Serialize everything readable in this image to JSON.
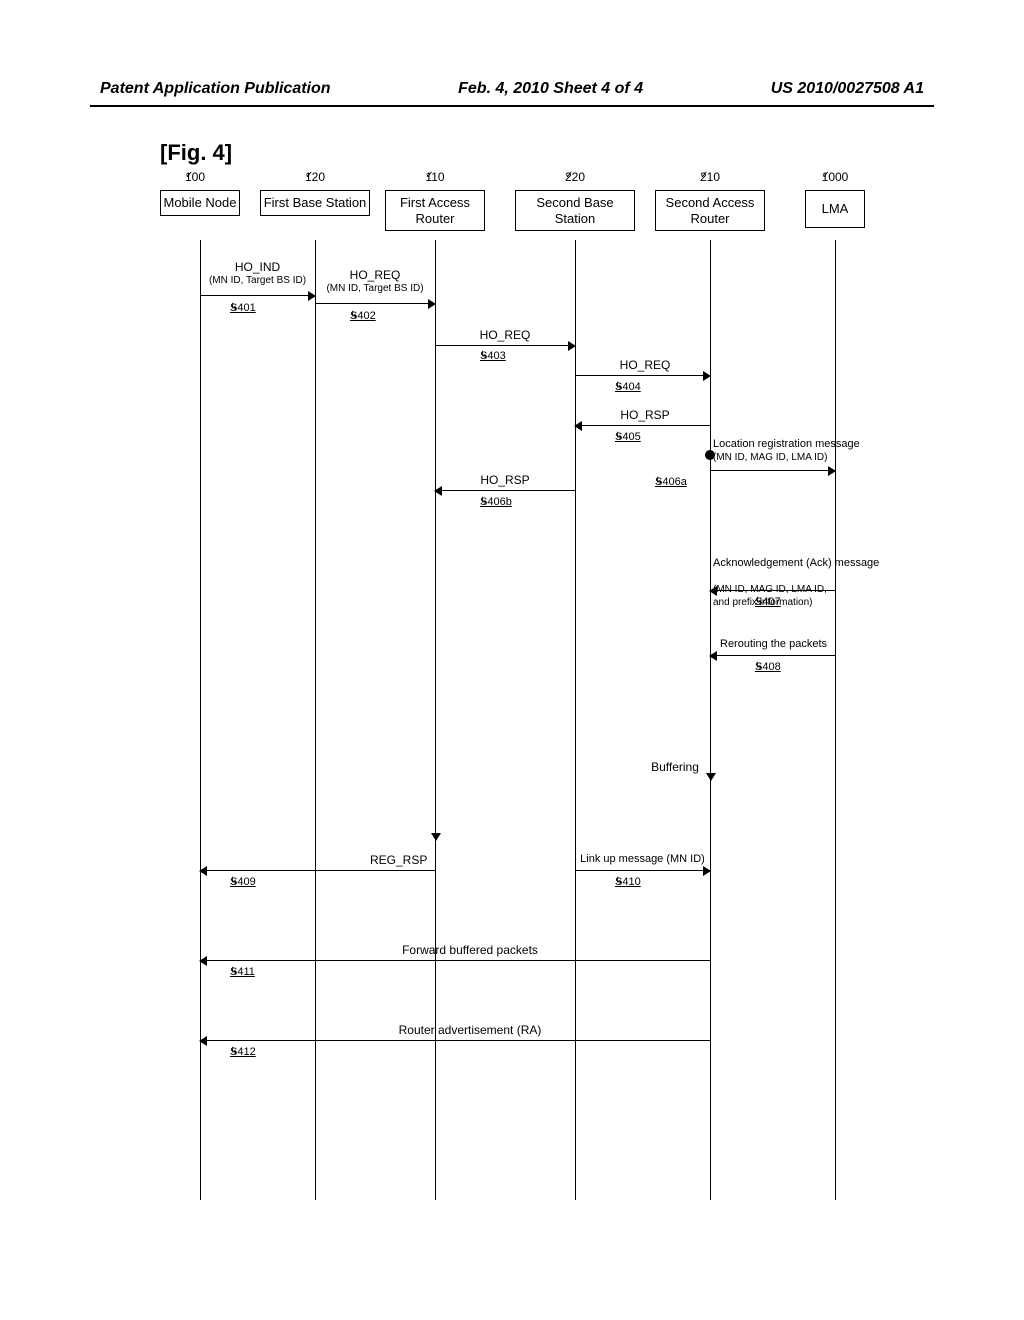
{
  "header": {
    "left": "Patent Application Publication",
    "center": "Feb. 4, 2010  Sheet 4 of 4",
    "right": "US 2010/0027508 A1"
  },
  "figure_label": "[Fig. 4]",
  "actors": {
    "mobile_node": {
      "name": "Mobile Node",
      "id": "100"
    },
    "first_bs": {
      "name": "First Base Station",
      "id": "120"
    },
    "first_ar": {
      "name": "First Access\nRouter",
      "id": "110"
    },
    "second_bs": {
      "name": "Second Base Station",
      "id": "220"
    },
    "second_ar": {
      "name": "Second Access\nRouter",
      "id": "210"
    },
    "lma": {
      "name": "LMA",
      "id": "1000"
    }
  },
  "messages": {
    "ho_ind": {
      "text": "HO_IND",
      "sub": "(MN ID, Target BS ID)",
      "step": "S401"
    },
    "ho_req1": {
      "text": "HO_REQ",
      "sub": "(MN ID, Target BS ID)",
      "step": "S402"
    },
    "ho_req2": {
      "text": "HO_REQ",
      "step": "S403"
    },
    "ho_req3": {
      "text": "HO_REQ",
      "step": "S404"
    },
    "ho_rsp1": {
      "text": "HO_RSP",
      "step": "S405"
    },
    "locreg": {
      "text": "Location registration message",
      "sub": "(MN ID, MAG ID, LMA ID)",
      "step": "S406a"
    },
    "ho_rsp2": {
      "text": "HO_RSP",
      "step": "S406b"
    },
    "ack": {
      "text": "Acknowledgement (Ack) message",
      "sub": "(MN ID, MAG ID, LMA ID,\nand prefix information)",
      "step": "S407"
    },
    "buffering": {
      "text": "Buffering"
    },
    "reroute": {
      "text": "Rerouting the packets",
      "step": "S408"
    },
    "reg_rsp": {
      "text": "REG_RSP",
      "step": "S409"
    },
    "link_up": {
      "text": "Link up message (MN ID)",
      "step": "S410"
    },
    "fwd": {
      "text": "Forward buffered packets",
      "step": "S411"
    },
    "ra": {
      "text": "Router advertisement (RA)",
      "step": "S412"
    }
  }
}
